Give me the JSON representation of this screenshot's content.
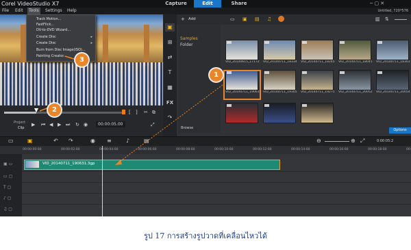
{
  "app": {
    "title": "Corel VideoStudio X7",
    "modes": [
      "Capture",
      "Edit",
      "Share"
    ],
    "active_mode": "Edit",
    "project_name": "Untitled, 720*576"
  },
  "menu": {
    "items": [
      "File",
      "Edit",
      "Tools",
      "Settings",
      "Help"
    ],
    "active": "Tools"
  },
  "tools_menu": {
    "items": [
      {
        "label": "Track Motion...",
        "submenu": false
      },
      {
        "label": "FastFlick...",
        "submenu": false
      },
      {
        "label": "DV-to-DVD Wizard...",
        "submenu": false
      },
      {
        "label": "Create Disc",
        "submenu": true
      },
      {
        "label": "Create Disc",
        "submenu": true
      },
      {
        "label": "Burn from Disc Image(ISO)...",
        "submenu": false
      },
      {
        "label": "Painting Creator...",
        "submenu": false
      }
    ]
  },
  "player": {
    "project_label": "Project",
    "clip_label": "Clip",
    "timecode": "00:00:05.00",
    "progress": 0.27
  },
  "library": {
    "add_label": "Add",
    "folders": [
      "Samples",
      "Folder"
    ],
    "browse_label": "Browse",
    "options_label": "Options",
    "thumbnails": [
      {
        "caption": "VID_20140615_17172...",
        "colors": [
          "#7a8fa8",
          "#e5e2da"
        ]
      },
      {
        "caption": "VID_20140711_18334...",
        "colors": [
          "#6b89b2",
          "#d6c9a8"
        ]
      },
      {
        "caption": "VID_20140711_18245...",
        "colors": [
          "#9b7b57",
          "#c9c3b6"
        ]
      },
      {
        "caption": "VID_20140711_18045...",
        "colors": [
          "#4f5a3c",
          "#b8a88a"
        ]
      },
      {
        "caption": "VID_20140711_18303...",
        "colors": [
          "#4b5b70",
          "#9fb2c6"
        ]
      },
      {
        "caption": "VID_20140711_19063...",
        "colors": [
          "#3d5a92",
          "#e8e4da"
        ]
      },
      {
        "caption": "VID_20140711_19305...",
        "colors": [
          "#5c4e3a",
          "#d7d2c5"
        ]
      },
      {
        "caption": "VID_20140711_19275...",
        "colors": [
          "#3a3f48",
          "#c4b48f"
        ]
      },
      {
        "caption": "VID_20140711_20052...",
        "colors": [
          "#2d3036",
          "#8a97a3"
        ]
      },
      {
        "caption": "VID_20140711_20054...",
        "colors": [
          "#1f2228",
          "#5a6675"
        ]
      },
      {
        "caption": "",
        "colors": [
          "#2b2e34",
          "#b02a2a"
        ]
      },
      {
        "caption": "",
        "colors": [
          "#1a1d25",
          "#3a4f8a"
        ]
      },
      {
        "caption": "",
        "colors": [
          "#2c2a28",
          "#cdb78b"
        ]
      }
    ]
  },
  "timeline": {
    "ruler": [
      "00:00:00:00",
      "00:00:02:00",
      "00:00:04:00",
      "00:00:06:00",
      "00:00:08:00",
      "00:00:10:00",
      "00:00:12:00",
      "00:00:14:00",
      "00:00:16:00",
      "00:00:18:00",
      "00:00:20:00",
      "00:00:22:00"
    ],
    "zoom_time": "0:00:05:2",
    "clip_name": "VID_20140711_190631.3gp"
  },
  "callouts": [
    "1",
    "2",
    "3"
  ],
  "caption": "รูป 17 การสร้างรูปวาดที่เคลื่อนไหวได้",
  "colors": {
    "accent": "#1877c9",
    "callout": "#e9862a",
    "clip": "#1f8a74"
  }
}
